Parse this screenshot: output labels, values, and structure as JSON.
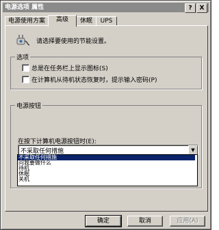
{
  "window": {
    "title": "电源选项 属性",
    "help_btn": "?",
    "close_btn": "X"
  },
  "tabs": [
    {
      "label": "电源使用方案"
    },
    {
      "label": "高级"
    },
    {
      "label": "休眠"
    },
    {
      "label": "UPS"
    }
  ],
  "intro": {
    "text": "请选择要使用的节能设置。",
    "icon": "power-plug-icon"
  },
  "options_group": {
    "legend": "选项",
    "items": [
      {
        "label": "总是在任务栏上显示图标(S)",
        "checked": false
      },
      {
        "label": "在计算机从待机状态恢复时，提示输入密码(P)",
        "checked": false
      }
    ]
  },
  "power_buttons_group": {
    "legend": "电源按钮",
    "combo_label": "在按下计算机电源按钮时(E):",
    "selected": "不采取任何措施",
    "options": [
      "不采取任何措施",
      "问我要做什么",
      "待机",
      "休眠",
      "关机"
    ]
  },
  "buttons": {
    "ok": "确定",
    "cancel": "取消",
    "apply": "应用(A)"
  },
  "colors": {
    "face": "#d4d0c8",
    "highlight": "#0a246a",
    "titlebar": "#8a8a8a"
  }
}
